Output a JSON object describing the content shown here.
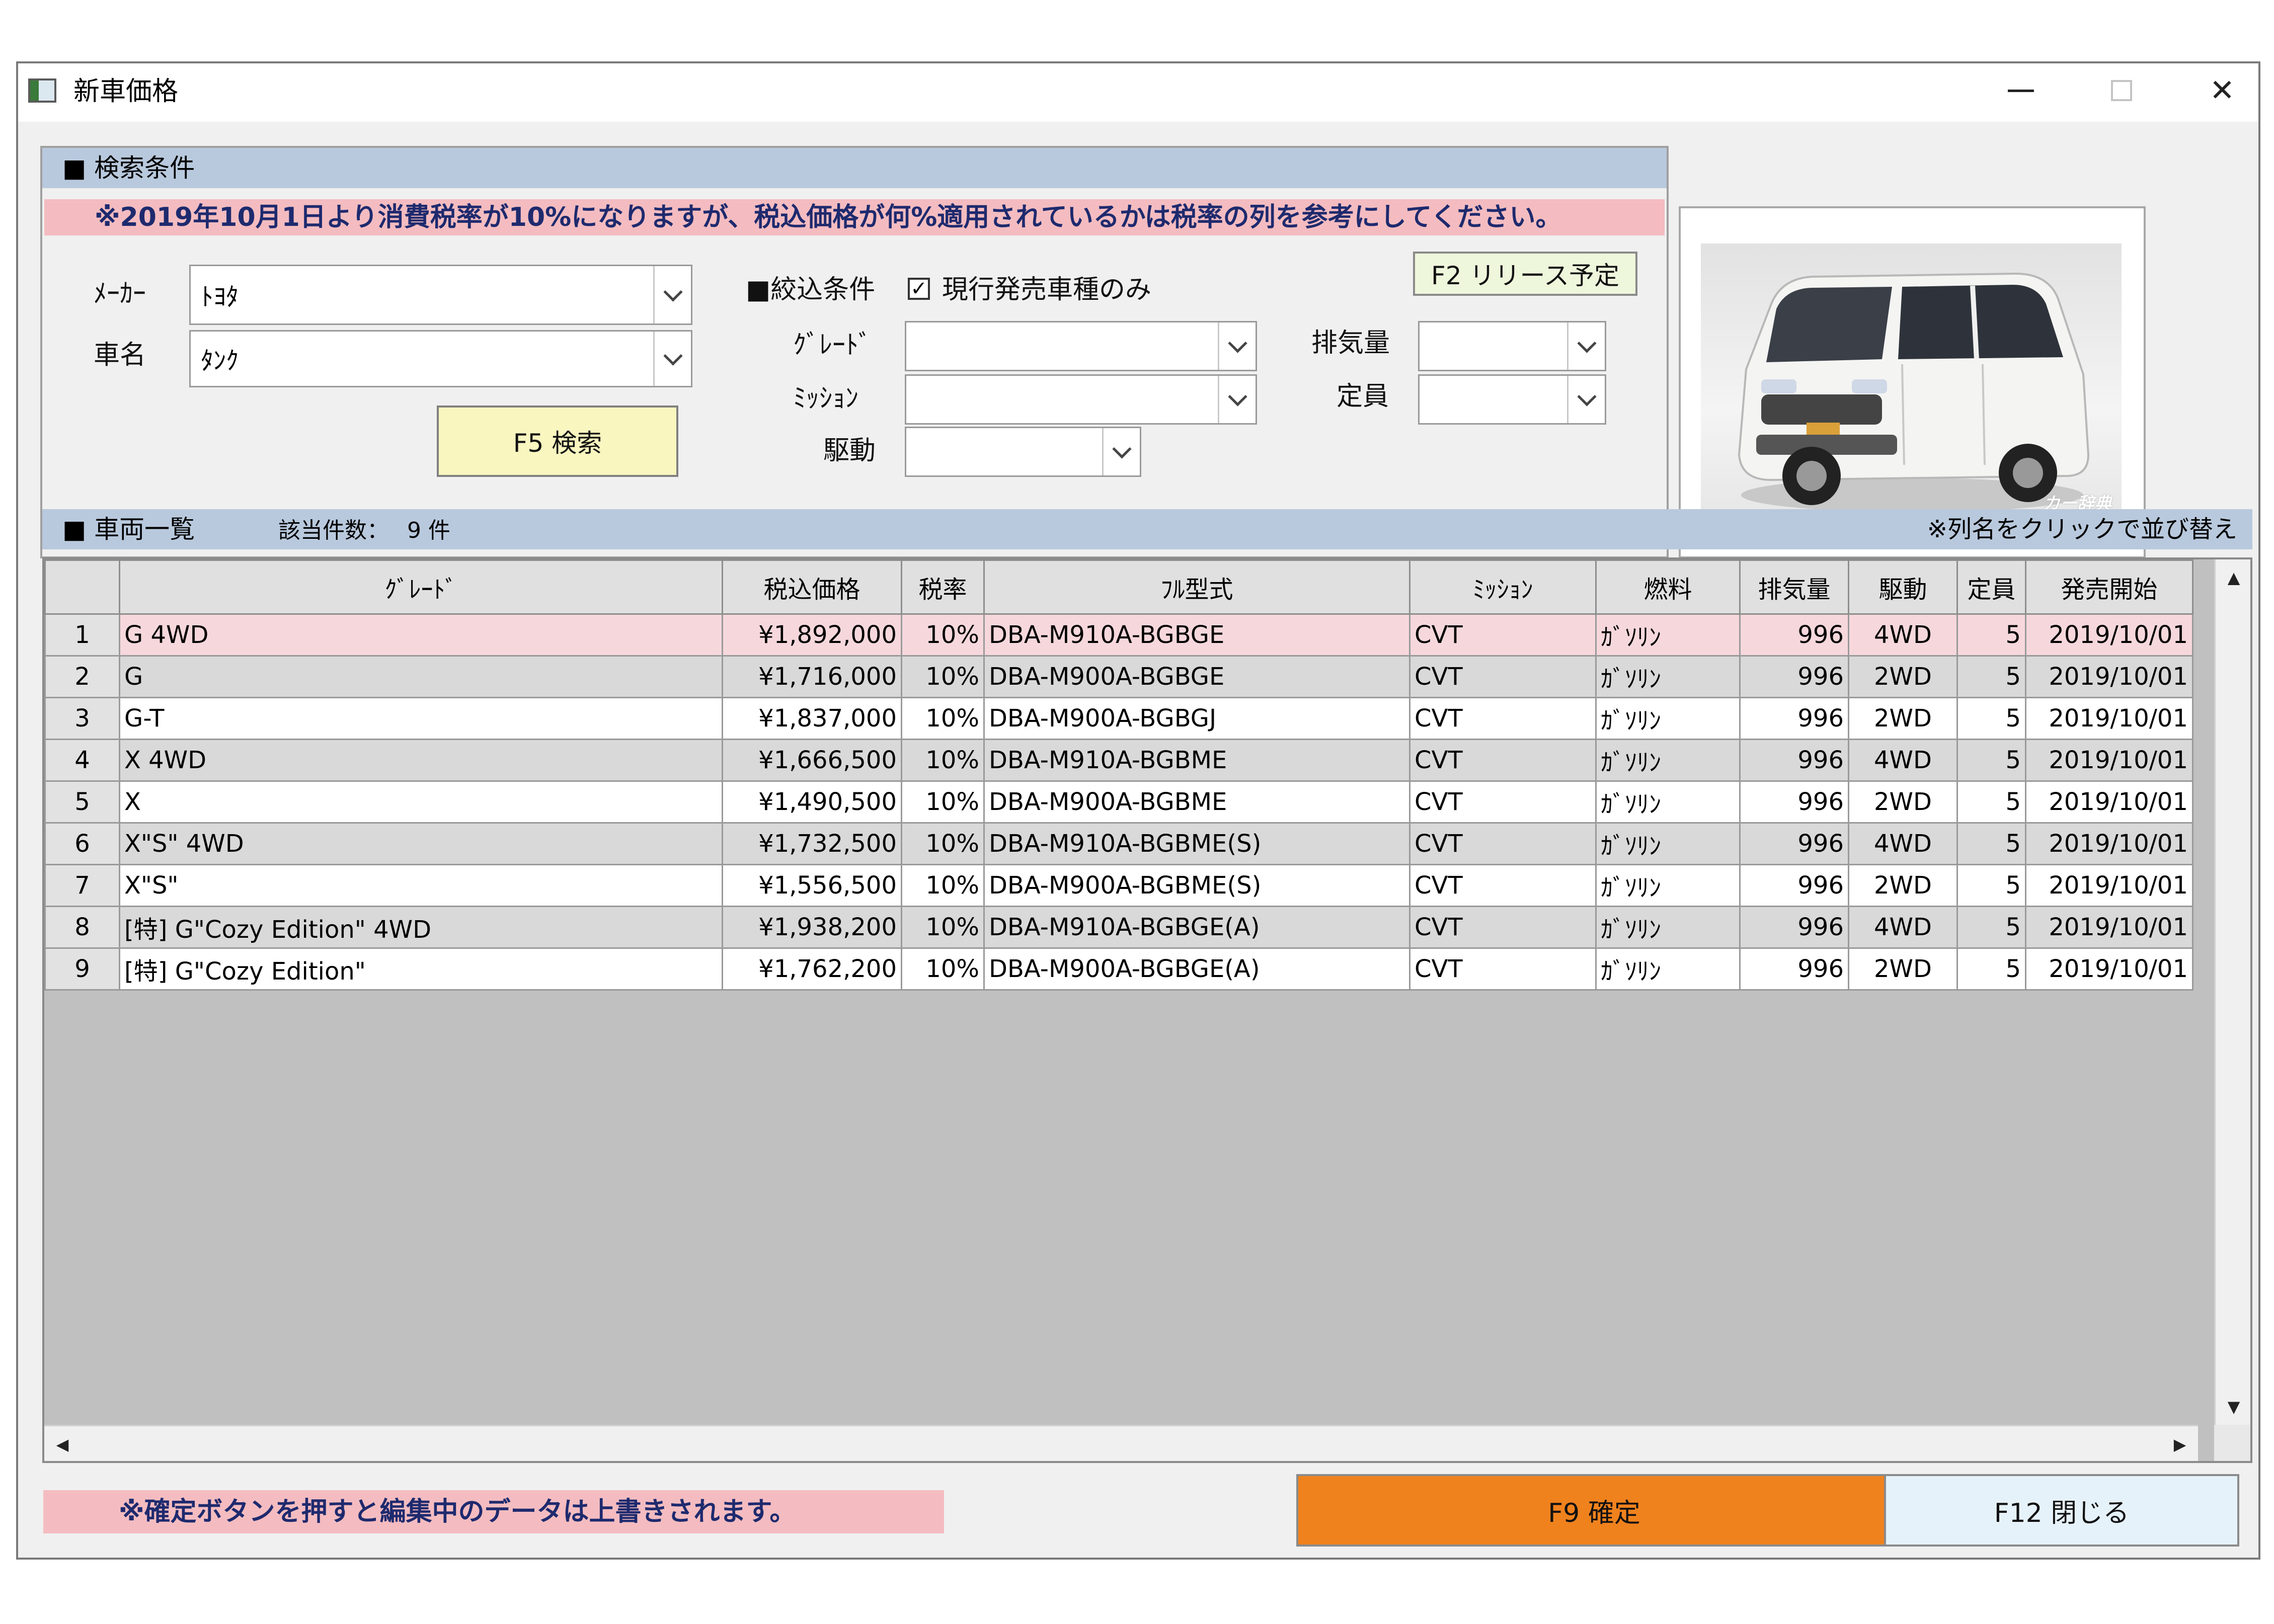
{
  "window": {
    "title": "新車価格"
  },
  "search": {
    "header": "■ 検索条件",
    "notice": "※2019年10月1日より消費税率が10%になりますが、税込価格が何%適用されているかは税率の列を参考にしてください。",
    "maker_label": "ﾒｰｶｰ",
    "maker_value": "ﾄﾖﾀ",
    "car_label": "車名",
    "car_value": "ﾀﾝｸ",
    "search_button": "F5 検索",
    "filter_label": "■絞込条件",
    "current_only_label": "現行発売車種のみ",
    "current_only_checked": "✓",
    "release_button": "F2 リリース予定",
    "grade_label": "ｸﾞﾚｰﾄﾞ",
    "mission_label": "ﾐｯｼｮﾝ",
    "drive_label": "駆動",
    "displacement_label": "排気量",
    "capacity_label": "定員"
  },
  "list": {
    "header": "■ 車両一覧",
    "count_label": "該当件数：",
    "count_value": "9 件",
    "sort_hint": "※列名をクリックで並び替え",
    "columns": [
      "",
      "ｸﾞﾚｰﾄﾞ",
      "税込価格",
      "税率",
      "ﾌﾙ型式",
      "ﾐｯｼｮﾝ",
      "燃料",
      "排気量",
      "駆動",
      "定員",
      "発売開始"
    ],
    "rows": [
      [
        "1",
        "G 4WD",
        "¥1,892,000",
        "10%",
        "DBA-M910A-BGBGE",
        "CVT",
        "ｶﾞｿﾘﾝ",
        "996",
        "4WD",
        "5",
        "2019/10/01"
      ],
      [
        "2",
        "G",
        "¥1,716,000",
        "10%",
        "DBA-M900A-BGBGE",
        "CVT",
        "ｶﾞｿﾘﾝ",
        "996",
        "2WD",
        "5",
        "2019/10/01"
      ],
      [
        "3",
        "G-T",
        "¥1,837,000",
        "10%",
        "DBA-M900A-BGBGJ",
        "CVT",
        "ｶﾞｿﾘﾝ",
        "996",
        "2WD",
        "5",
        "2019/10/01"
      ],
      [
        "4",
        "X 4WD",
        "¥1,666,500",
        "10%",
        "DBA-M910A-BGBME",
        "CVT",
        "ｶﾞｿﾘﾝ",
        "996",
        "4WD",
        "5",
        "2019/10/01"
      ],
      [
        "5",
        "X",
        "¥1,490,500",
        "10%",
        "DBA-M900A-BGBME",
        "CVT",
        "ｶﾞｿﾘﾝ",
        "996",
        "2WD",
        "5",
        "2019/10/01"
      ],
      [
        "6",
        "X\"S\" 4WD",
        "¥1,732,500",
        "10%",
        "DBA-M910A-BGBME(S)",
        "CVT",
        "ｶﾞｿﾘﾝ",
        "996",
        "4WD",
        "5",
        "2019/10/01"
      ],
      [
        "7",
        "X\"S\"",
        "¥1,556,500",
        "10%",
        "DBA-M900A-BGBME(S)",
        "CVT",
        "ｶﾞｿﾘﾝ",
        "996",
        "2WD",
        "5",
        "2019/10/01"
      ],
      [
        "8",
        "[特] G\"Cozy Edition\" 4WD",
        "¥1,938,200",
        "10%",
        "DBA-M910A-BGBGE(A)",
        "CVT",
        "ｶﾞｿﾘﾝ",
        "996",
        "4WD",
        "5",
        "2019/10/01"
      ],
      [
        "9",
        "[特] G\"Cozy Edition\"",
        "¥1,762,200",
        "10%",
        "DBA-M900A-BGBGE(A)",
        "CVT",
        "ｶﾞｿﾘﾝ",
        "996",
        "2WD",
        "5",
        "2019/10/01"
      ]
    ]
  },
  "car_image": {
    "watermark": "カー辞典"
  },
  "footer": {
    "warning": "※確定ボタンを押すと編集中のデータは上書きされます。",
    "confirm_button": "F9 確定",
    "close_button": "F12 閉じる"
  },
  "colors": {
    "section_header": "#b9c9dd",
    "notice_bg": "#f4bcc0",
    "notice_text": "#1e2a6e",
    "search_button_bg": "#faf6c0",
    "release_button_bg": "#eef7dc",
    "confirm_button_bg": "#f0821e",
    "close_button_bg": "#e6f2fa",
    "selected_row": "#f6d8dc"
  }
}
